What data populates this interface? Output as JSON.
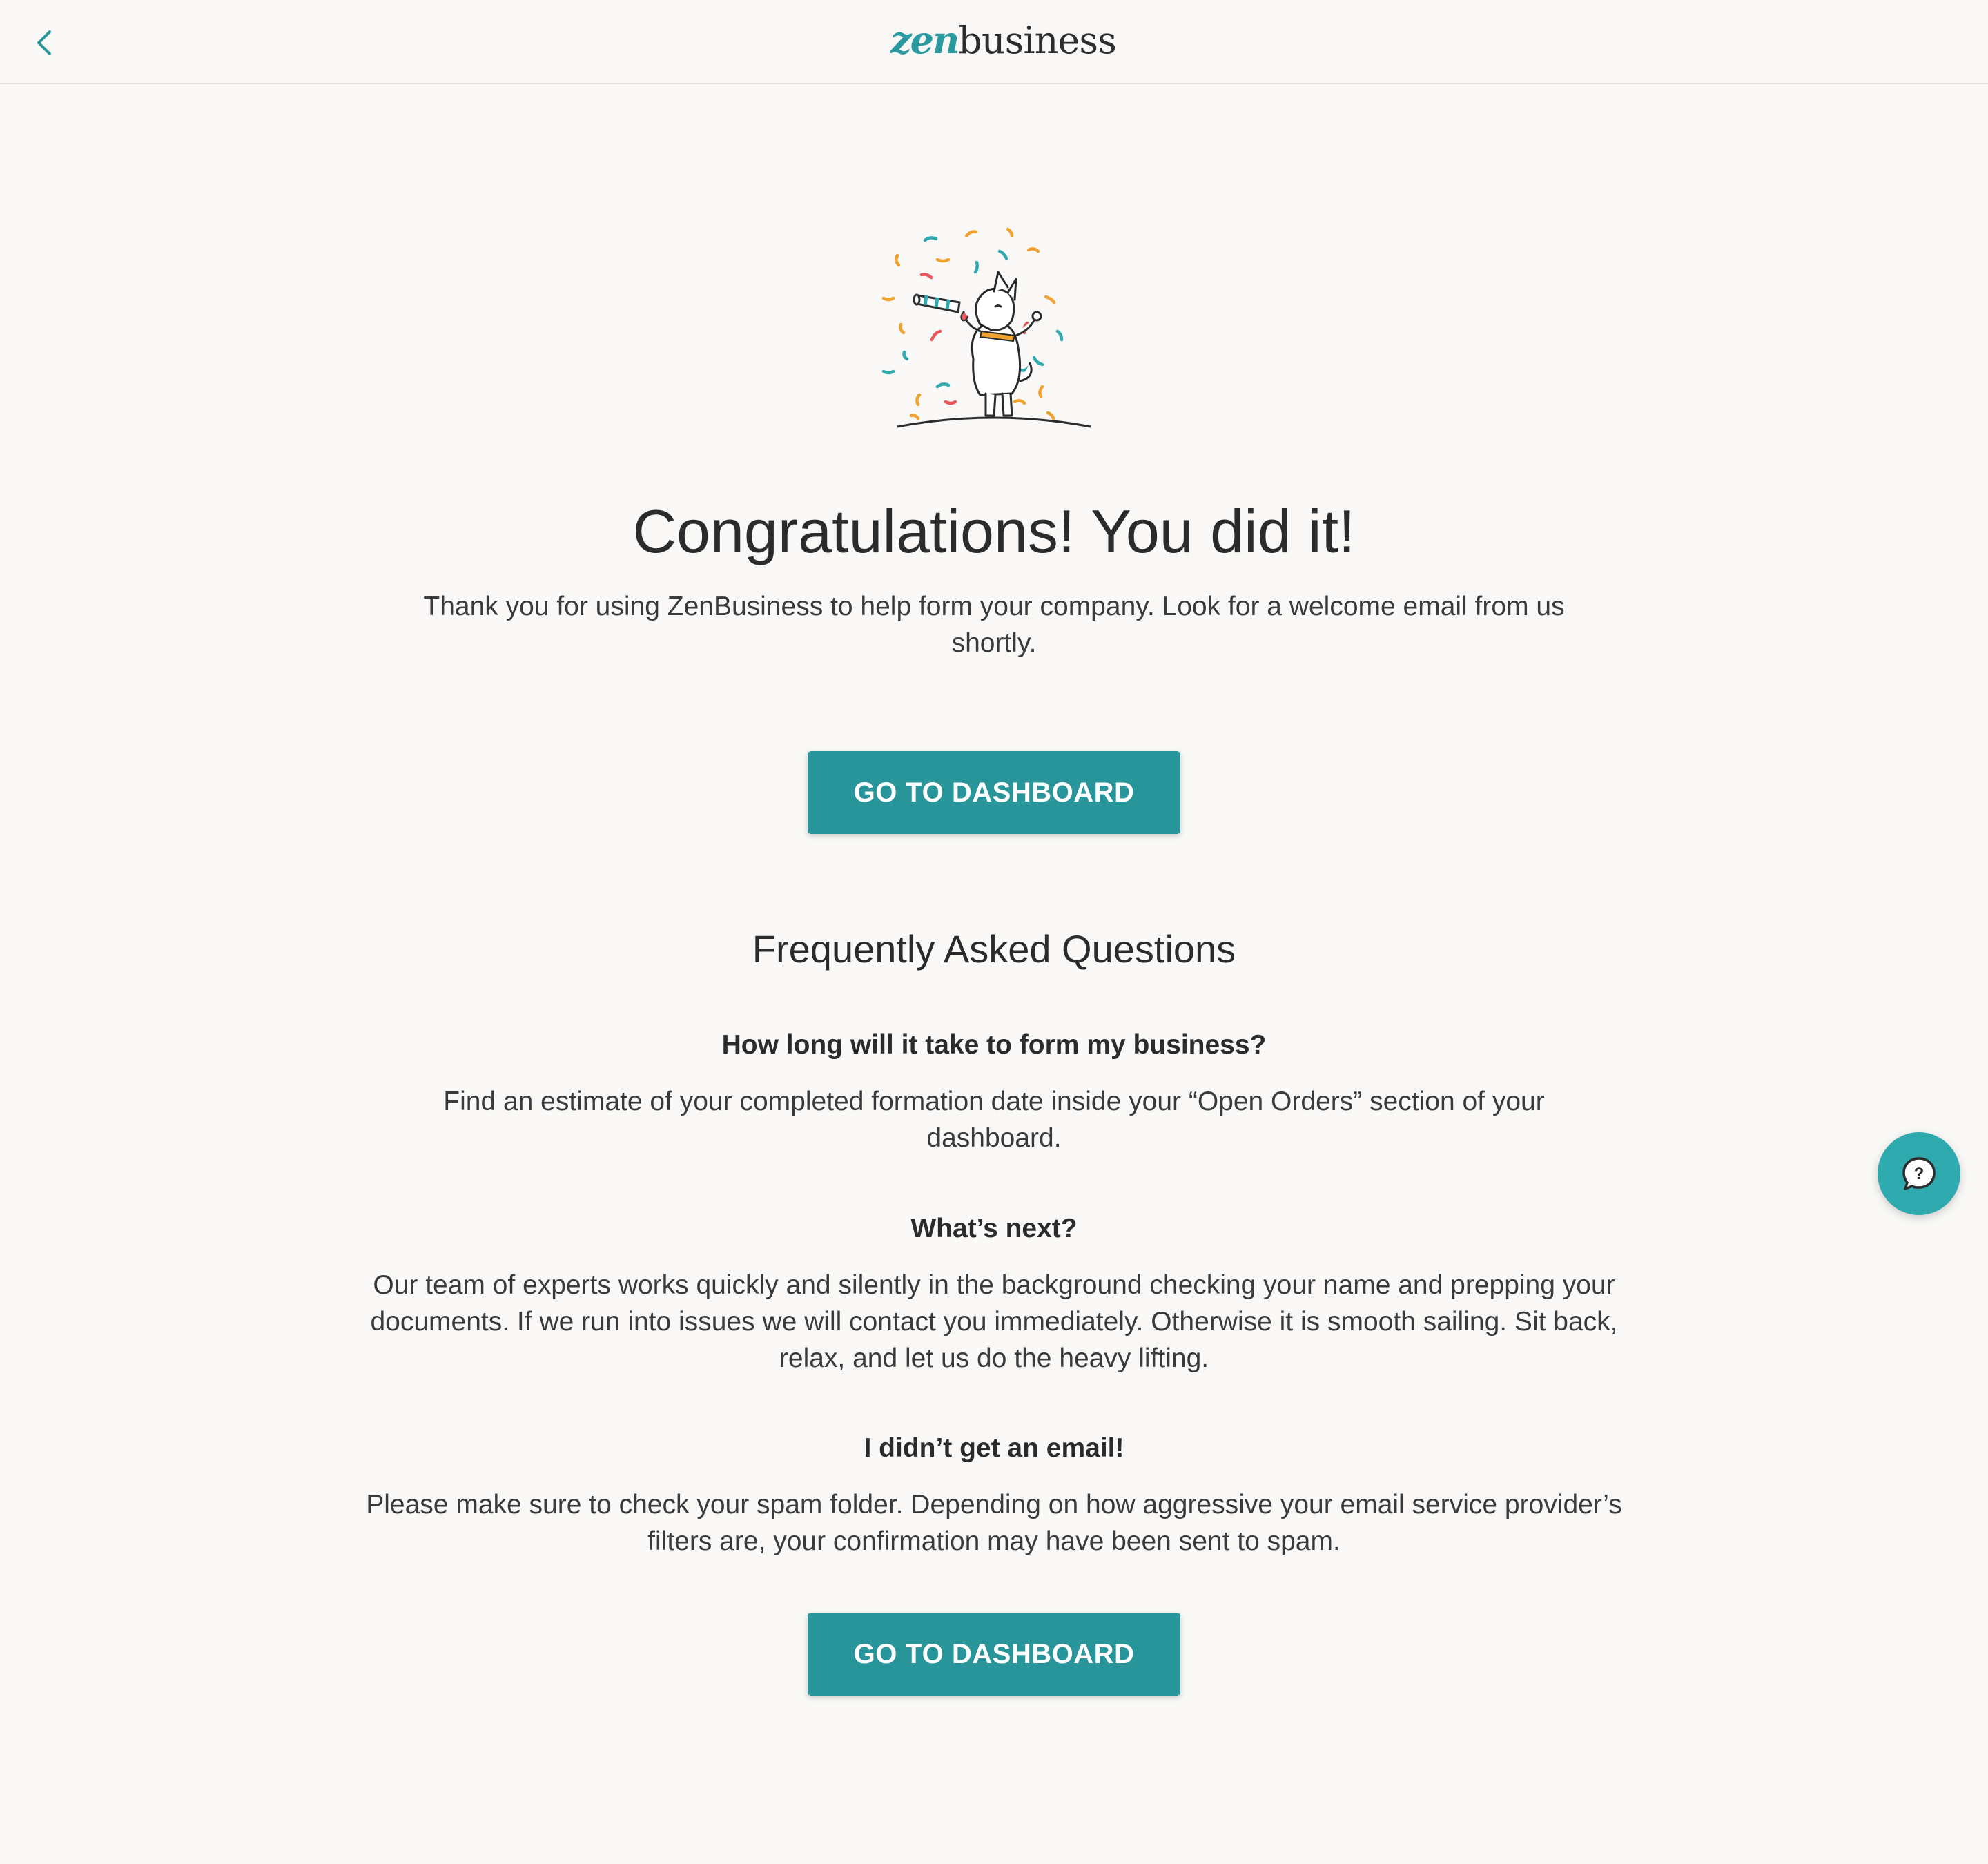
{
  "header": {
    "back_icon": "chevron-left-icon",
    "logo_part1": "zen",
    "logo_part2": "business"
  },
  "hero": {
    "illustration": "celebrating-dog-with-party-horn-and-confetti",
    "title": "Congratulations! You did it!",
    "subtitle": "Thank you for using ZenBusiness to help form your company. Look for a welcome email from us shortly."
  },
  "buttons": {
    "dashboard_top": "GO TO DASHBOARD",
    "dashboard_bottom": "GO TO DASHBOARD"
  },
  "faq": {
    "heading": "Frequently Asked Questions",
    "items": [
      {
        "question": "How long will it take to form my business?",
        "answer": "Find an estimate of your completed formation date inside your “Open Orders” section of your dashboard."
      },
      {
        "question": "What’s next?",
        "answer": "Our team of experts works quickly and silently in the background checking your name and prepping your documents. If we run into issues we will contact you immediately. Otherwise it is smooth sailing. Sit back, relax, and let us do the heavy lifting."
      },
      {
        "question": "I didn’t get an email!",
        "answer": "Please make sure to check your spam folder. Depending on how aggressive your email service provider’s filters are, your confirmation may have been sent to spam."
      }
    ]
  },
  "help_widget": {
    "icon": "help-chat-icon"
  },
  "colors": {
    "brand_teal": "#27959a",
    "help_teal": "#2ea9ad",
    "background": "#f9f8f6",
    "text": "#2b2b2b"
  }
}
